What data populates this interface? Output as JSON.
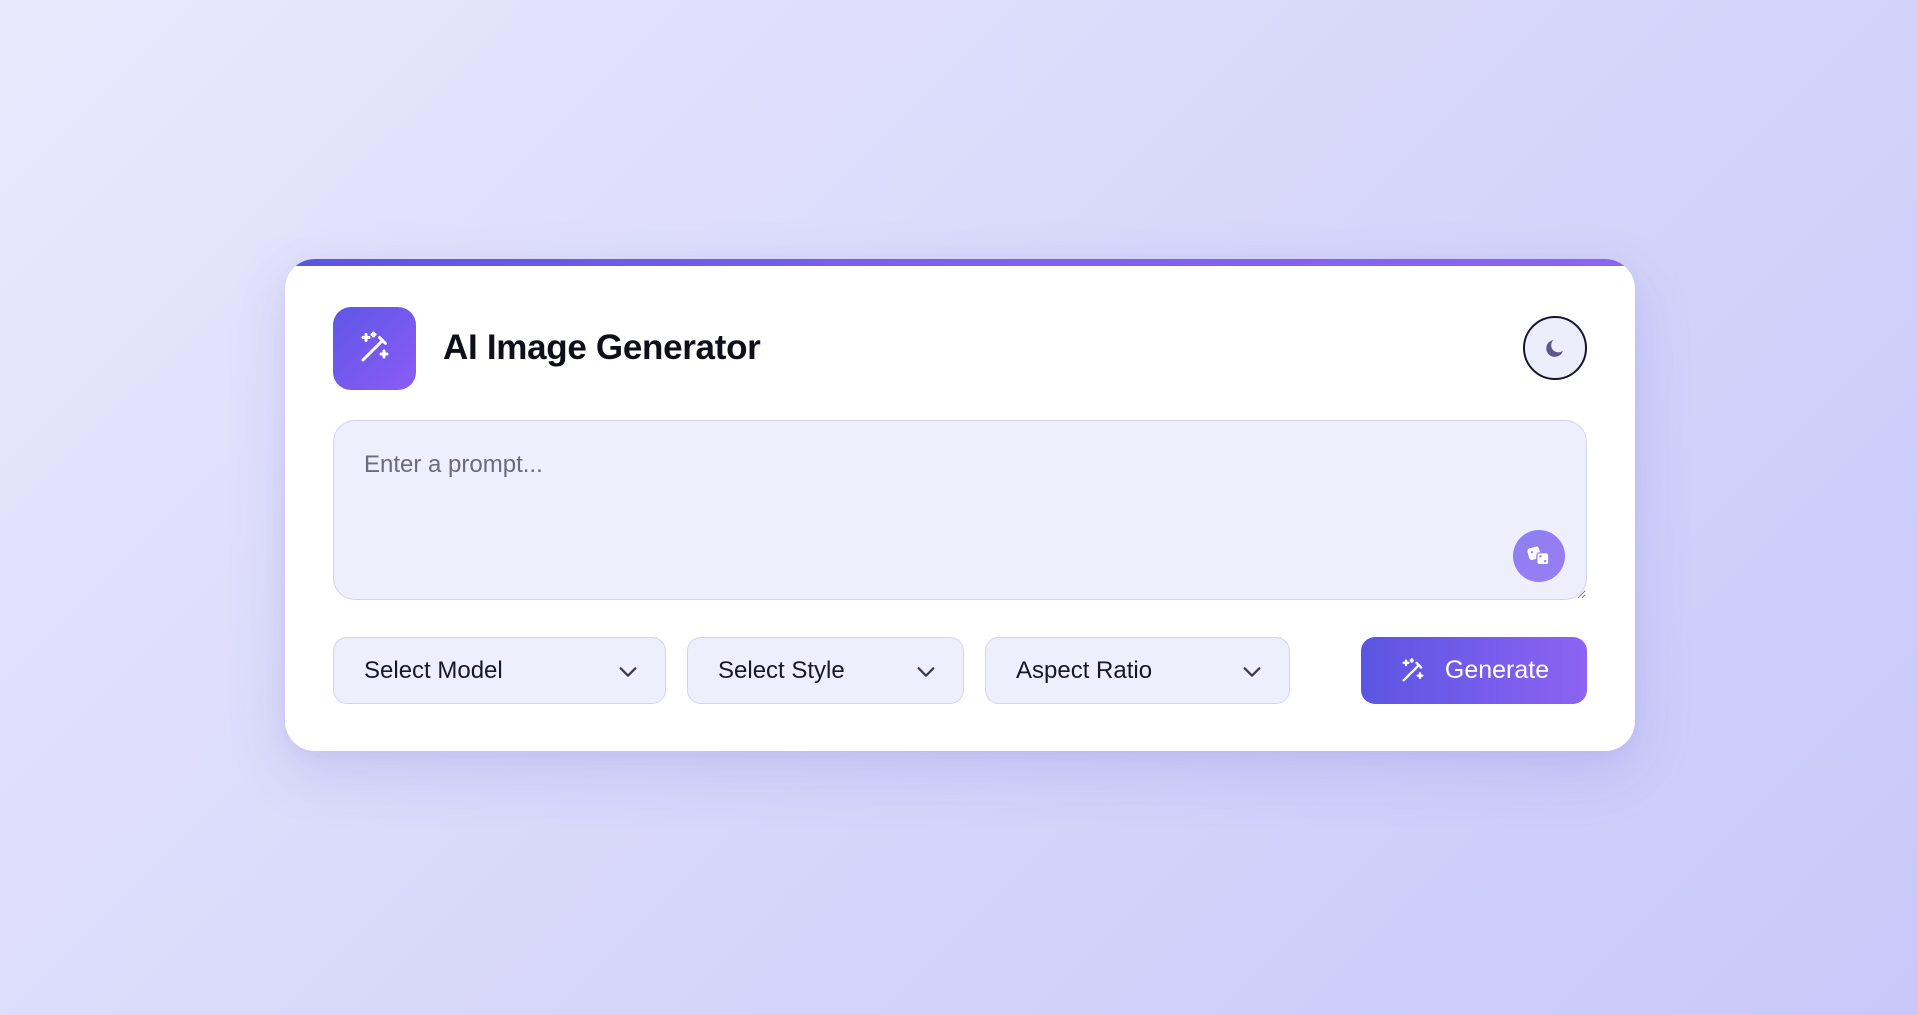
{
  "app": {
    "title": "AI Image Generator",
    "logo_icon": "magic-wand-sparkles-icon"
  },
  "header": {
    "theme_toggle_icon": "moon-icon"
  },
  "prompt": {
    "value": "",
    "placeholder": "Enter a prompt...",
    "random_button_icon": "dice-icon"
  },
  "controls": {
    "model_select": {
      "label": "Select Model"
    },
    "style_select": {
      "label": "Select Style"
    },
    "aspect_ratio_select": {
      "label": "Aspect Ratio"
    },
    "generate_button": {
      "label": "Generate",
      "icon": "magic-wand-sparkles-icon"
    }
  },
  "colors": {
    "accent_start": "#5b55e2",
    "accent_end": "#8d63f2",
    "field_bg": "#efeefc",
    "page_bg": "#dcdcfb"
  }
}
